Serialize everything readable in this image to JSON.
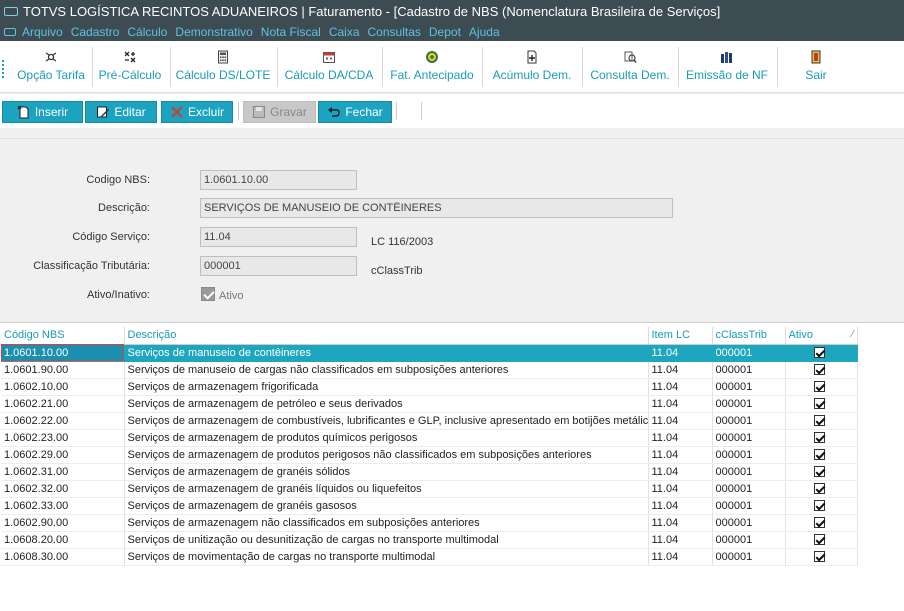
{
  "window": {
    "title": "TOTVS LOGÍSTICA RECINTOS ADUANEIROS | Faturamento - [Cadastro de NBS (Nomenclatura Brasileira de Serviços]"
  },
  "menu": [
    "Arquivo",
    "Cadastro",
    "Cálculo",
    "Demonstrativo",
    "Nota Fiscal",
    "Caixa",
    "Consultas",
    "Depot",
    "Ajuda"
  ],
  "toolbar": {
    "items": [
      {
        "label": "Opção Tarifa",
        "icon": "tariff-option-icon"
      },
      {
        "label": "Pré-Cálculo",
        "icon": "pre-calculation-icon"
      },
      {
        "label": "Cálculo DS/LOTE",
        "icon": "calculator-icon"
      },
      {
        "label": "Cálculo DA/CDA",
        "icon": "calendar-icon"
      },
      {
        "label": "Fat. Antecipado",
        "icon": "coin-icon"
      },
      {
        "label": "Acúmulo Dem.",
        "icon": "document-add-icon"
      },
      {
        "label": "Consulta Dem.",
        "icon": "search-document-icon"
      },
      {
        "label": "Emissão de NF",
        "icon": "invoice-icon"
      },
      {
        "label": "Sair",
        "icon": "exit-door-icon"
      }
    ]
  },
  "actions": {
    "insert": "Inserir",
    "edit": "Editar",
    "delete": "Excluir",
    "save": "Gravar",
    "close": "Fechar"
  },
  "form": {
    "codigo_nbs": {
      "label": "Codigo NBS:",
      "value": "1.0601.10.00"
    },
    "descricao": {
      "label": "Descrição:",
      "value": "SERVIÇOS DE MANUSEIO DE CONTÊINERES"
    },
    "codigo_servico": {
      "label": "Código Serviço:",
      "value": "11.04",
      "hint": "LC 116/2003"
    },
    "classificacao": {
      "label": "Classificação Tributária:",
      "value": "000001",
      "hint": "cClassTrib"
    },
    "ativo": {
      "label": "Ativo/Inativo:",
      "text": "Ativo",
      "checked": true
    }
  },
  "grid": {
    "columns": [
      "Código NBS",
      "Descrição",
      "Item LC",
      "cClassTrib",
      "Ativo"
    ],
    "rows": [
      {
        "codigo": "1.0601.10.00",
        "descricao": "Serviços de manuseio de contêineres",
        "item_lc": "11.04",
        "cclass": "000001",
        "ativo": true,
        "selected": true
      },
      {
        "codigo": "1.0601.90.00",
        "descricao": "Serviços de manuseio de cargas não classificados em subposições anteriores",
        "item_lc": "11.04",
        "cclass": "000001",
        "ativo": true
      },
      {
        "codigo": "1.0602.10.00",
        "descricao": "Serviços de armazenagem frigorificada",
        "item_lc": "11.04",
        "cclass": "000001",
        "ativo": true
      },
      {
        "codigo": "1.0602.21.00",
        "descricao": "Serviços de armazenagem de petróleo e seus derivados",
        "item_lc": "11.04",
        "cclass": "000001",
        "ativo": true
      },
      {
        "codigo": "1.0602.22.00",
        "descricao": "Serviços de armazenagem de combustíveis, lubrificantes e GLP, inclusive apresentado em botijões metálicos",
        "item_lc": "11.04",
        "cclass": "000001",
        "ativo": true
      },
      {
        "codigo": "1.0602.23.00",
        "descricao": "Serviços de armazenagem de produtos químicos perigosos",
        "item_lc": "11.04",
        "cclass": "000001",
        "ativo": true
      },
      {
        "codigo": "1.0602.29.00",
        "descricao": "Serviços de armazenagem de produtos perigosos não classificados em subposições anteriores",
        "item_lc": "11.04",
        "cclass": "000001",
        "ativo": true
      },
      {
        "codigo": "1.0602.31.00",
        "descricao": "Serviços de armazenagem de granéis sólidos",
        "item_lc": "11.04",
        "cclass": "000001",
        "ativo": true
      },
      {
        "codigo": "1.0602.32.00",
        "descricao": "Serviços de armazenagem de granéis líquidos ou liquefeitos",
        "item_lc": "11.04",
        "cclass": "000001",
        "ativo": true
      },
      {
        "codigo": "1.0602.33.00",
        "descricao": "Serviços de armazenagem de granéis gasosos",
        "item_lc": "11.04",
        "cclass": "000001",
        "ativo": true
      },
      {
        "codigo": "1.0602.90.00",
        "descricao": "Serviços de armazenagem não classificados em subposições anteriores",
        "item_lc": "11.04",
        "cclass": "000001",
        "ativo": true
      },
      {
        "codigo": "1.0608.20.00",
        "descricao": "Serviços de unitização ou desunitização de cargas no transporte multimodal",
        "item_lc": "11.04",
        "cclass": "000001",
        "ativo": true
      },
      {
        "codigo": "1.0608.30.00",
        "descricao": "Serviços de movimentação de cargas no transporte multimodal",
        "item_lc": "11.04",
        "cclass": "000001",
        "ativo": true
      }
    ]
  },
  "colors": {
    "accent": "#1ba3c0",
    "titlebar": "#3d4b52",
    "menu_text": "#5ec3e3",
    "selected_row": "#1ea6bf"
  }
}
